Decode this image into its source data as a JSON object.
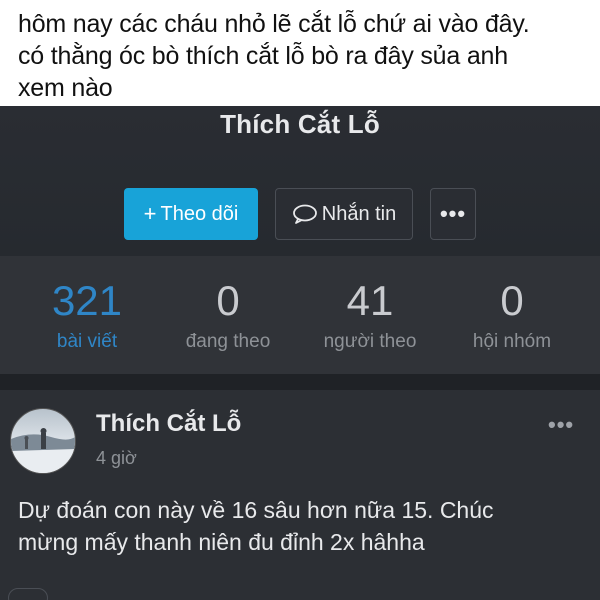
{
  "caption": {
    "line1": "hôm nay các cháu nhỏ lẽ cắt lỗ chứ ai vào đây.",
    "line2": "có thằng óc bò thích cắt lỗ bò ra đây sủa anh",
    "line3": "xem nào"
  },
  "profile": {
    "name": "Thích Cắt Lỗ",
    "follow_label": "Theo dõi",
    "message_label": "Nhắn tin",
    "more_label": "•••"
  },
  "stats": [
    {
      "value": "321",
      "label": "bài viết"
    },
    {
      "value": "0",
      "label": "đang theo"
    },
    {
      "value": "41",
      "label": "người theo"
    },
    {
      "value": "0",
      "label": "hội nhóm"
    }
  ],
  "post": {
    "author": "Thích Cắt Lỗ",
    "time": "4 giờ",
    "more_label": "•••",
    "text_line1": "Dự đoán con này về 16 sâu hơn nữa 15. Chúc",
    "text_line2": "mừng mấy thanh niên đu đỉnh 2x hâhha"
  },
  "colors": {
    "accent": "#18a3d8",
    "stat_active": "#2f86c7",
    "background_dark": "#2a2d33"
  },
  "icons": [
    "plus-icon",
    "message-bubble-icon",
    "more-dots-icon"
  ]
}
